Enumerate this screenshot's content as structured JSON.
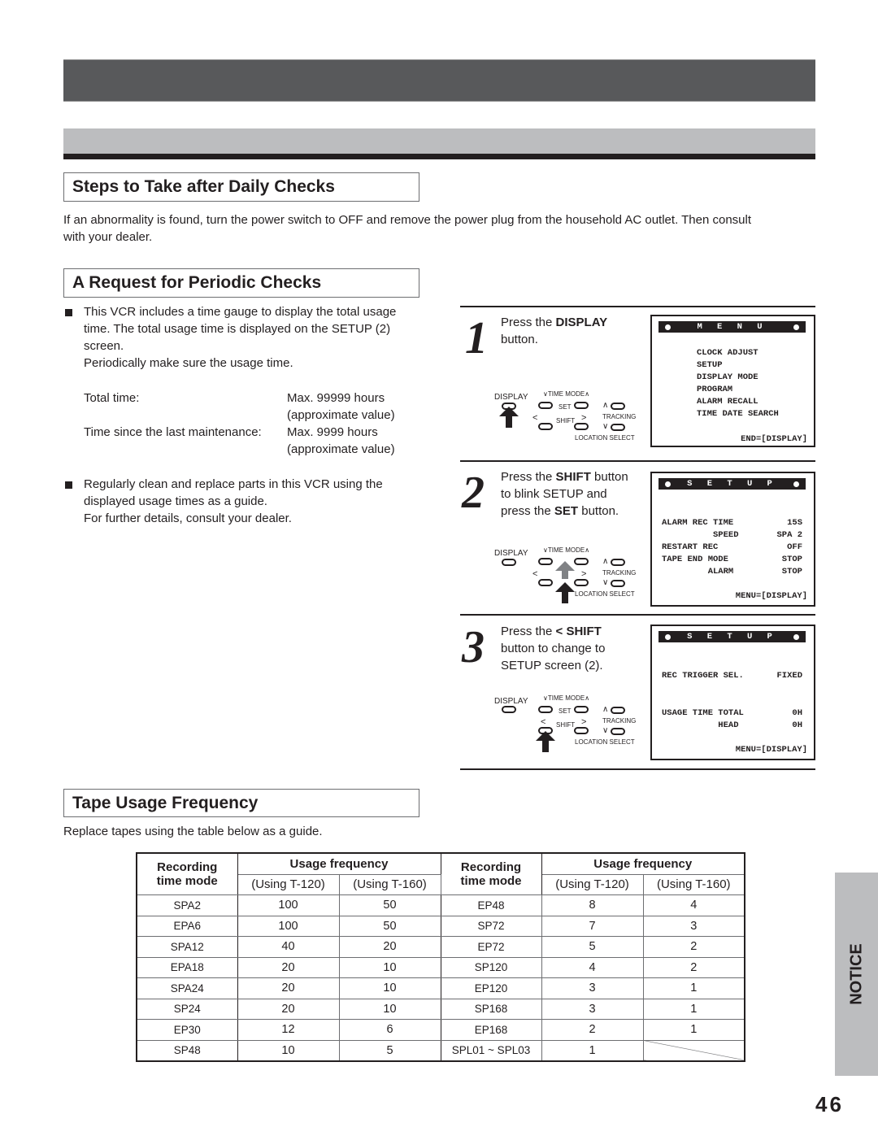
{
  "sections": {
    "daily": {
      "heading": "Steps to Take after Daily Checks",
      "text_line1": "If an abnormality is found, turn the power switch to OFF and remove the power plug from the household AC outlet. Then consult",
      "text_line2": "with your dealer."
    },
    "periodic": {
      "heading": "A Request for Periodic Checks",
      "bullet1": {
        "lines": [
          "This VCR includes a time gauge to display the total usage",
          "time. The total usage time is displayed on the SETUP (2)",
          "screen.",
          "Periodically make sure the usage time."
        ]
      },
      "specs": [
        {
          "label": "Total time:",
          "value": "Max. 99999 hours",
          "note": "(approximate value)"
        },
        {
          "label": "Time since the last maintenance:",
          "value": "Max. 9999 hours",
          "note": "(approximate value)"
        }
      ],
      "bullet2": {
        "lines": [
          "Regularly clean and replace parts in this VCR using the",
          "displayed usage times as a guide.",
          "For further details, consult your dealer."
        ]
      }
    },
    "tape": {
      "heading": "Tape Usage Frequency",
      "intro": "Replace tapes using the table below as a guide."
    }
  },
  "steps": [
    {
      "number": "1",
      "text_parts": {
        "a": "Press the ",
        "b": "DISPLAY",
        "c": "button."
      },
      "screen": {
        "title": "M E N U",
        "lines": [
          "CLOCK ADJUST",
          "SETUP",
          "DISPLAY MODE",
          "PROGRAM",
          "ALARM RECALL",
          "TIME DATE SEARCH"
        ],
        "footer": "END=[DISPLAY]"
      }
    },
    {
      "number": "2",
      "text_parts": {
        "a": "Press the ",
        "b": "SHIFT",
        "c": " button",
        "d": "to blink SETUP and",
        "e": "press the ",
        "f": "SET",
        "g": " button."
      },
      "screen": {
        "title": "S E T U P",
        "rows": [
          {
            "label": "ALARM REC TIME",
            "value": "15S"
          },
          {
            "label": "          SPEED",
            "value": "SPA 2"
          },
          {
            "label": "RESTART REC",
            "value": "OFF"
          },
          {
            "label": "TAPE END MODE",
            "value": "STOP"
          },
          {
            "label": "         ALARM",
            "value": "STOP"
          }
        ],
        "footer": "MENU=[DISPLAY]"
      }
    },
    {
      "number": "3",
      "text_parts": {
        "a": "Press the ",
        "b": "< SHIFT",
        "c": "button to change to",
        "d": "SETUP screen (2)."
      },
      "screen": {
        "title": "S E T U P",
        "rows": [
          {
            "label": "REC TRIGGER SEL.",
            "value": "FIXED"
          },
          {
            "label": "USAGE TIME TOTAL",
            "value": "0H"
          },
          {
            "label": "           HEAD",
            "value": "0H"
          }
        ],
        "footer": "MENU=[DISPLAY]"
      }
    }
  ],
  "remote": {
    "display": "DISPLAY",
    "time_mode": "TIME MODE",
    "set": "SET",
    "shift": "SHIFT",
    "tracking": "TRACKING",
    "location_select": "LOCATION SELECT"
  },
  "table": {
    "header_mode": "Recording\ntime mode",
    "header_mode_l1": "Recording",
    "header_mode_l2": "time mode",
    "header_usage": "Usage frequency",
    "sub_t120": "(Using T-120)",
    "sub_t160": "(Using T-160)",
    "rows": [
      {
        "mode_a": "SPA2",
        "a120": "100",
        "a160": "50",
        "mode_b": "EP48",
        "b120": "8",
        "b160": "4"
      },
      {
        "mode_a": "EPA6",
        "a120": "100",
        "a160": "50",
        "mode_b": "SP72",
        "b120": "7",
        "b160": "3"
      },
      {
        "mode_a": "SPA12",
        "a120": "40",
        "a160": "20",
        "mode_b": "EP72",
        "b120": "5",
        "b160": "2"
      },
      {
        "mode_a": "EPA18",
        "a120": "20",
        "a160": "10",
        "mode_b": "SP120",
        "b120": "4",
        "b160": "2"
      },
      {
        "mode_a": "SPA24",
        "a120": "20",
        "a160": "10",
        "mode_b": "EP120",
        "b120": "3",
        "b160": "1"
      },
      {
        "mode_a": "SP24",
        "a120": "20",
        "a160": "10",
        "mode_b": "SP168",
        "b120": "3",
        "b160": "1"
      },
      {
        "mode_a": "EP30",
        "a120": "12",
        "a160": "6",
        "mode_b": "EP168",
        "b120": "2",
        "b160": "1"
      },
      {
        "mode_a": "SP48",
        "a120": "10",
        "a160": "5",
        "mode_b": "SPL01 ~ SPL03",
        "b120": "1",
        "b160": ""
      }
    ]
  },
  "side_tab": "NOTICE",
  "page_number": "46"
}
